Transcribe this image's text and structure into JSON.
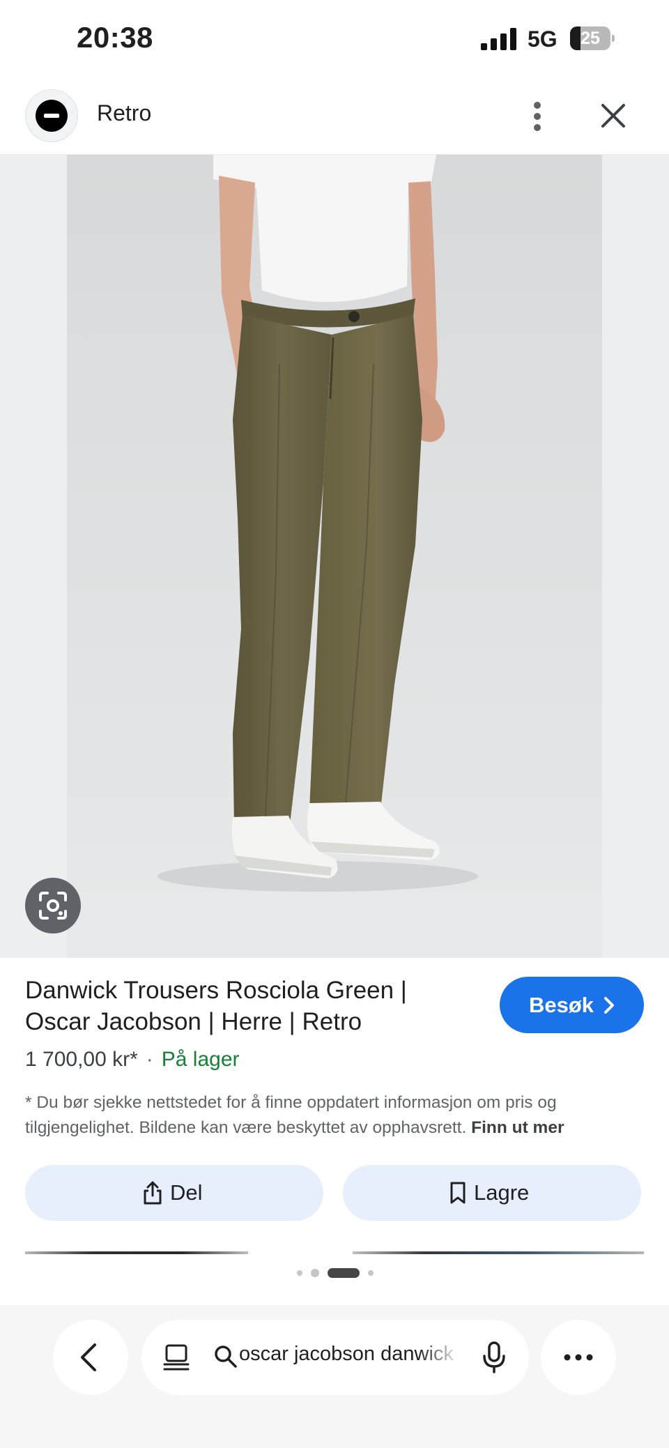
{
  "status_bar": {
    "time": "20:38",
    "network": "5G",
    "battery": "25",
    "battery_level": 0.25
  },
  "header": {
    "site_name": "Retro",
    "icons": {
      "logo": "site-logo",
      "more": "vertical-dots-icon",
      "close": "close-icon"
    }
  },
  "product": {
    "title": "Danwick Trousers Rosciola Green | Oscar Jacobson | Herre | Retro",
    "price": "1 700,00 kr*",
    "separator": "·",
    "availability": "På lager",
    "visit_label": "Besøk",
    "disclaimer": "* Du bør sjekke nettstedet for å finne oppdatert informasjon om pris og tilgjengelighet. Bildene kan være beskyttet av opphavsrett.",
    "learn_more": "Finn ut mer"
  },
  "actions": {
    "share_label": "Del",
    "save_label": "Lagre"
  },
  "pager": {
    "count": 4,
    "active_index": 2
  },
  "bottom_nav": {
    "query": "oscar jacobson danwick trousers",
    "icons": {
      "back": "chevron-left-icon",
      "tabs": "tabs-icon",
      "search": "search-icon",
      "mic": "mic-icon",
      "menu": "horizontal-dots-icon"
    }
  },
  "colors": {
    "accent": "#1a73e8",
    "in_stock": "#188038",
    "action_bg": "#e8effc",
    "trouser_olive": "#6b6447"
  }
}
